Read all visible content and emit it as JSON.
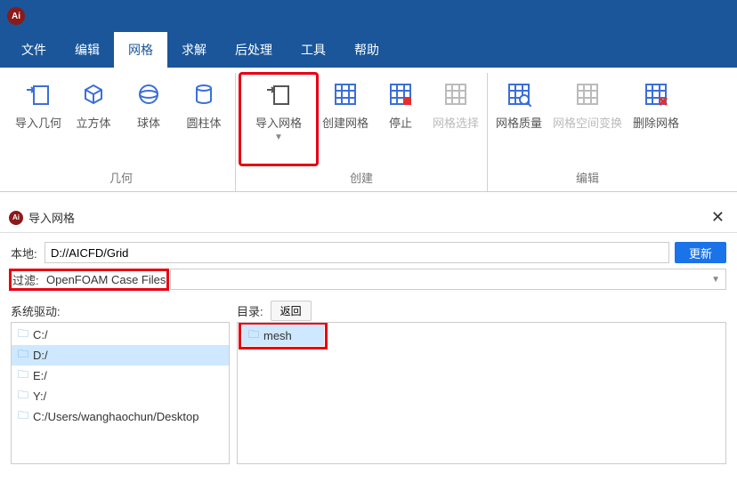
{
  "app": {
    "icon_text": "Ai"
  },
  "menubar": {
    "items": [
      "文件",
      "编辑",
      "网格",
      "求解",
      "后处理",
      "工具",
      "帮助"
    ],
    "active_index": 2
  },
  "ribbon": {
    "groups": [
      {
        "title": "几何",
        "buttons": [
          {
            "name": "import-geometry",
            "label": "导入几何",
            "icon": "import-box"
          },
          {
            "name": "cube",
            "label": "立方体",
            "icon": "cube"
          },
          {
            "name": "sphere",
            "label": "球体",
            "icon": "sphere"
          },
          {
            "name": "cylinder",
            "label": "圆柱体",
            "icon": "cylinder"
          }
        ]
      },
      {
        "title": "创建",
        "buttons": [
          {
            "name": "import-mesh",
            "label": "导入网格",
            "icon": "import-grid",
            "dropdown": true,
            "highlighted": true
          },
          {
            "name": "create-mesh",
            "label": "创建网格",
            "icon": "grid"
          },
          {
            "name": "stop",
            "label": "停止",
            "icon": "grid-stop"
          },
          {
            "name": "mesh-select",
            "label": "网格选择",
            "icon": "grid-select",
            "disabled": true
          }
        ]
      },
      {
        "title": "编辑",
        "buttons": [
          {
            "name": "mesh-quality",
            "label": "网格质量",
            "icon": "grid-search"
          },
          {
            "name": "mesh-transform",
            "label": "网格空间变换",
            "icon": "grid-transform",
            "disabled": true,
            "wide": true
          },
          {
            "name": "delete-mesh",
            "label": "删除网格",
            "icon": "grid-delete"
          }
        ]
      }
    ]
  },
  "dialog": {
    "title": "导入网格",
    "local_label": "本地:",
    "local_value": "D://AICFD/Grid",
    "update_btn": "更新",
    "filter_label": "过滤:",
    "filter_value": "OpenFOAM Case Files",
    "drives_label": "系统驱动:",
    "dir_label": "目录:",
    "back_btn": "返回",
    "drives": [
      "C:/",
      "D:/",
      "E:/",
      "Y:/",
      "C:/Users/wanghaochun/Desktop"
    ],
    "drives_selected_index": 1,
    "dir_items": [
      "mesh"
    ],
    "dir_selected_index": 0
  }
}
